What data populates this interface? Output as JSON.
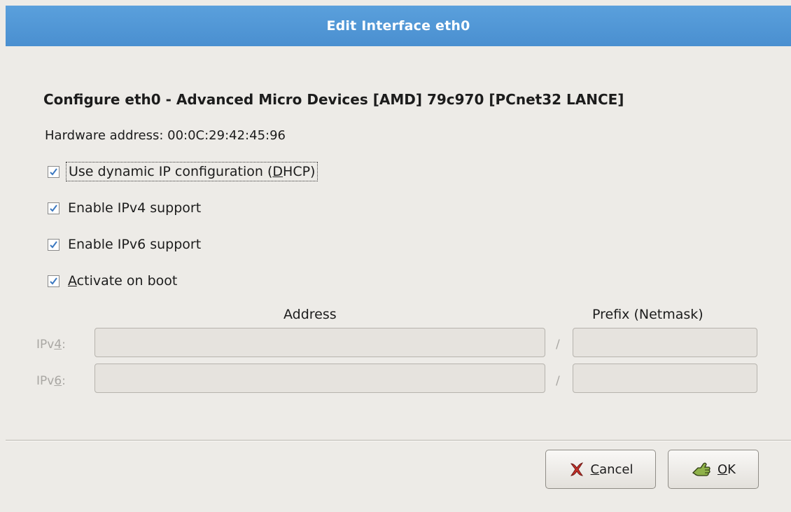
{
  "window": {
    "title": "Edit Interface eth0"
  },
  "heading": "Configure eth0 - Advanced Micro Devices [AMD] 79c970 [PCnet32 LANCE]",
  "hardware_address": "Hardware address: 00:0C:29:42:45:96",
  "options": [
    {
      "pre": "Use dynamic IP configuration (",
      "mnemonic": "D",
      "post": "HCP)",
      "checked": true
    },
    {
      "pre": "Enable IPv4 support",
      "mnemonic": "",
      "post": "",
      "checked": true
    },
    {
      "pre": "Enable IPv6 support",
      "mnemonic": "",
      "post": "",
      "checked": true
    },
    {
      "pre": "",
      "mnemonic": "A",
      "post": "ctivate on boot",
      "checked": true
    }
  ],
  "table": {
    "address_header": "Address",
    "prefix_header": "Prefix (Netmask)",
    "separator": "/",
    "rows": [
      {
        "label_pre": "IPv",
        "label_mnemonic": "4",
        "label_post": ":",
        "address": "",
        "prefix": ""
      },
      {
        "label_pre": "IPv",
        "label_mnemonic": "6",
        "label_post": ":",
        "address": "",
        "prefix": ""
      }
    ]
  },
  "buttons": {
    "cancel_mnemonic": "C",
    "cancel_rest": "ancel",
    "ok_mnemonic": "O",
    "ok_rest": "K"
  },
  "icons": {
    "cancel": "x-mark-icon",
    "ok": "ok-hand-icon",
    "check": "checkmark-icon"
  },
  "colors": {
    "titlebar": "#4a8fd0",
    "check": "#3b78c0"
  }
}
